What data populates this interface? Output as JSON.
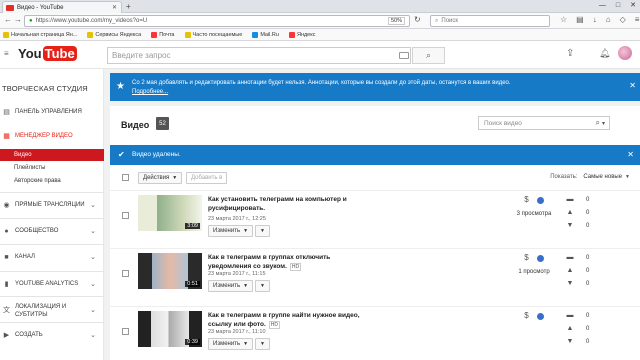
{
  "browser": {
    "tab_title": "Видео - YouTube",
    "url": "https://www.youtube.com/my_videos?o=U",
    "zoom": "50%",
    "search_placeholder": "Поиск",
    "bookmarks": [
      {
        "label": "Начальная страница Ян...",
        "color": "#e8c200"
      },
      {
        "label": "Сервисы Яндекса",
        "color": "#e8c200"
      },
      {
        "label": "Почта",
        "color": "#ff3333"
      },
      {
        "label": "Часто посещаемые",
        "color": "#e8c200"
      },
      {
        "label": "Mail.Ru",
        "color": "#168de2"
      },
      {
        "label": "Яндекс",
        "color": "#ff3333"
      }
    ]
  },
  "youtube": {
    "logo_you": "You",
    "logo_tube": "Tube",
    "search_placeholder": "Введите запрос"
  },
  "sidebar": {
    "studio_title": "ТВОРЧЕСКАЯ СТУДИЯ",
    "items": [
      {
        "label": "ПАНЕЛЬ УПРАВЛЕНИЯ",
        "icon": "dashboard-icon",
        "glyph": "▤",
        "chevron": false,
        "active": false
      },
      {
        "label": "МЕНЕДЖЕР ВИДЕО",
        "icon": "video-manager-icon",
        "glyph": "▦",
        "chevron": false,
        "active": true
      }
    ],
    "subitems": [
      {
        "label": "Видео",
        "selected": true
      },
      {
        "label": "Плейлисты",
        "selected": false
      },
      {
        "label": "Авторские права",
        "selected": false
      }
    ],
    "sections": [
      {
        "label": "ПРЯМЫЕ ТРАНСЛЯЦИИ",
        "icon": "live-icon",
        "glyph": "◉"
      },
      {
        "label": "СООБЩЕСТВО",
        "icon": "community-icon",
        "glyph": "●"
      },
      {
        "label": "КАНАЛ",
        "icon": "channel-icon",
        "glyph": "■"
      },
      {
        "label": "YOUTUBE ANALYTICS",
        "icon": "analytics-icon",
        "glyph": "▮"
      },
      {
        "label": "ЛОКАЛИЗАЦИЯ И СУБТИТРЫ",
        "icon": "translate-icon",
        "glyph": "文"
      },
      {
        "label": "СОЗДАТЬ",
        "icon": "create-icon",
        "glyph": "▶"
      }
    ]
  },
  "banner": {
    "text": "Со 2 мая добавлять и редактировать аннотации будет нельзя. Аннотации, которые вы создали до этой даты, останутся в ваших видео.",
    "link": "Подробнее..."
  },
  "videos_header": {
    "title": "Видео",
    "count": "52",
    "search_placeholder": "Поиск видео"
  },
  "notice": {
    "text": "Видео удалены."
  },
  "toolbar": {
    "actions_label": "Действия",
    "add_to_label": "Добавить в",
    "show_label": "Показать:",
    "sort_label": "Самые новые"
  },
  "videos": [
    {
      "title": "Как установить телеграмм на компьютер и русифицировать.",
      "hd": "",
      "date": "23 марта 2017 г., 12:25",
      "duration": "3:09",
      "views": "3 просмотра",
      "likes": "0",
      "dislikes": "0",
      "comments": "0",
      "edit_label": "Изменить"
    },
    {
      "title": "Как в телеграмм в группах отключить уведомления со звуком.",
      "hd": "HD",
      "date": "23 марта 2017 г., 11:15",
      "duration": "0:51",
      "views": "1 просмотр",
      "likes": "0",
      "dislikes": "0",
      "comments": "0",
      "edit_label": "Изменить"
    },
    {
      "title": "Как в телеграмм в группе найти нужное видео, ссылку или фото.",
      "hd": "HD",
      "date": "23 марта 2017 г., 11:10",
      "duration": "0:39",
      "views": "",
      "likes": "0",
      "dislikes": "0",
      "comments": "0",
      "edit_label": "Изменить"
    }
  ],
  "colors": {
    "brand_red": "#e62117",
    "info_blue": "#167ac6",
    "selected_red": "#cc181e"
  }
}
